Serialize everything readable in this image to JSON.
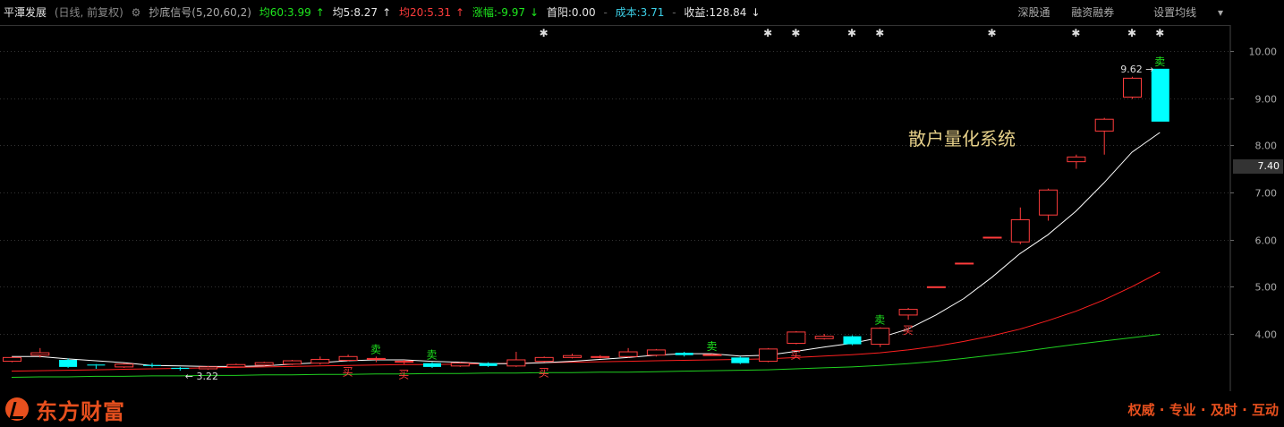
{
  "header": {
    "stock_name": "平潭发展",
    "period": "(日线, 前复权)",
    "indicator": "抄底信号(5,20,60,2)",
    "ma60": "均60:3.99",
    "ma5": "均5:8.27",
    "ma20": "均20:5.31",
    "change": "涨幅:-9.97",
    "first_yang": "首阳:0.00",
    "cost": "成本:3.71",
    "profit": "收益:128.84"
  },
  "menu": {
    "shen_gu_tong": "深股通",
    "margin": "融资融券",
    "set_ma": "设置均线"
  },
  "footer": {
    "brand": "东方财富",
    "slogan": "权威 · 专业 · 及时 · 互动"
  },
  "current_price": "7.40",
  "colors": {
    "up": "#ff3c3c",
    "down": "#00ffff",
    "ma5": "#ffffff",
    "ma20": "#ff2020",
    "ma60": "#20d020",
    "signal": "#1ee61e",
    "grid": "#333333",
    "axis_text": "#aaaaaa"
  },
  "chart_data": {
    "type": "candlestick",
    "ylim": [
      3.0,
      10.5
    ],
    "yticks": [
      "4.00",
      "5.00",
      "6.00",
      "7.00",
      "8.00",
      "9.00",
      "10.00"
    ],
    "watermark": "散户量化系统",
    "max_label": "9.62",
    "min_label": "3.22",
    "candles": [
      [
        3.42,
        3.5,
        3.4,
        3.52
      ],
      [
        3.55,
        3.6,
        3.5,
        3.7
      ],
      [
        3.45,
        3.3,
        3.28,
        3.48
      ],
      [
        3.35,
        3.33,
        3.26,
        3.36
      ],
      [
        3.3,
        3.36,
        3.28,
        3.38
      ],
      [
        3.34,
        3.32,
        3.29,
        3.38
      ],
      [
        3.28,
        3.26,
        3.22,
        3.3
      ],
      [
        3.26,
        3.3,
        3.24,
        3.32
      ],
      [
        3.3,
        3.35,
        3.29,
        3.37
      ],
      [
        3.34,
        3.39,
        3.32,
        3.41
      ],
      [
        3.36,
        3.43,
        3.34,
        3.45
      ],
      [
        3.38,
        3.46,
        3.35,
        3.52
      ],
      [
        3.44,
        3.52,
        3.42,
        3.56
      ],
      [
        3.46,
        3.48,
        3.4,
        3.52
      ],
      [
        3.4,
        3.42,
        3.36,
        3.45
      ],
      [
        3.38,
        3.3,
        3.28,
        3.4
      ],
      [
        3.32,
        3.38,
        3.3,
        3.4
      ],
      [
        3.38,
        3.32,
        3.3,
        3.4
      ],
      [
        3.32,
        3.45,
        3.3,
        3.62
      ],
      [
        3.42,
        3.5,
        3.4,
        3.52
      ],
      [
        3.5,
        3.54,
        3.48,
        3.58
      ],
      [
        3.5,
        3.52,
        3.48,
        3.55
      ],
      [
        3.52,
        3.62,
        3.5,
        3.7
      ],
      [
        3.55,
        3.66,
        3.52,
        3.68
      ],
      [
        3.6,
        3.55,
        3.52,
        3.62
      ],
      [
        3.55,
        3.56,
        3.54,
        3.58
      ],
      [
        3.5,
        3.38,
        3.36,
        3.52
      ],
      [
        3.42,
        3.68,
        3.4,
        3.7
      ],
      [
        3.8,
        4.04,
        3.78,
        4.06
      ],
      [
        3.9,
        3.95,
        3.88,
        4.0
      ],
      [
        3.95,
        3.78,
        3.76,
        3.97
      ],
      [
        3.78,
        4.12,
        3.72,
        4.14
      ],
      [
        4.4,
        4.52,
        4.3,
        4.55
      ],
      [
        5.0,
        5.0,
        5.0,
        5.0
      ],
      [
        5.5,
        5.5,
        5.5,
        5.5
      ],
      [
        6.05,
        6.05,
        6.05,
        6.05
      ],
      [
        5.95,
        6.42,
        5.9,
        6.68
      ],
      [
        6.52,
        7.05,
        6.4,
        7.08
      ],
      [
        7.65,
        7.75,
        7.5,
        7.8
      ],
      [
        8.3,
        8.55,
        7.8,
        8.58
      ],
      [
        9.02,
        9.42,
        8.98,
        9.45
      ],
      [
        9.62,
        8.5,
        8.5,
        9.62
      ]
    ],
    "ma5": [
      3.52,
      3.52,
      3.47,
      3.43,
      3.39,
      3.33,
      3.32,
      3.31,
      3.31,
      3.32,
      3.36,
      3.39,
      3.43,
      3.45,
      3.45,
      3.42,
      3.4,
      3.37,
      3.37,
      3.39,
      3.42,
      3.46,
      3.5,
      3.55,
      3.58,
      3.58,
      3.53,
      3.55,
      3.63,
      3.72,
      3.8,
      3.92,
      4.1,
      4.4,
      4.75,
      5.2,
      5.7,
      6.1,
      6.6,
      7.2,
      7.85,
      8.27
    ],
    "ma20": [
      3.21,
      3.22,
      3.23,
      3.24,
      3.25,
      3.26,
      3.27,
      3.28,
      3.29,
      3.3,
      3.31,
      3.32,
      3.33,
      3.34,
      3.35,
      3.35,
      3.36,
      3.37,
      3.38,
      3.39,
      3.4,
      3.41,
      3.42,
      3.43,
      3.44,
      3.45,
      3.46,
      3.47,
      3.5,
      3.53,
      3.56,
      3.6,
      3.66,
      3.74,
      3.84,
      3.96,
      4.1,
      4.28,
      4.48,
      4.72,
      5.0,
      5.31
    ],
    "ma60": [
      3.08,
      3.09,
      3.09,
      3.1,
      3.1,
      3.11,
      3.11,
      3.12,
      3.12,
      3.13,
      3.13,
      3.14,
      3.14,
      3.15,
      3.15,
      3.16,
      3.16,
      3.17,
      3.17,
      3.18,
      3.18,
      3.19,
      3.19,
      3.2,
      3.21,
      3.22,
      3.23,
      3.24,
      3.26,
      3.28,
      3.3,
      3.33,
      3.37,
      3.42,
      3.48,
      3.55,
      3.62,
      3.7,
      3.78,
      3.85,
      3.92,
      3.99
    ],
    "buy_signals": [
      12,
      14,
      19,
      28,
      32
    ],
    "buy_label": "买",
    "sell_signals": [
      13,
      15,
      25,
      31,
      41
    ],
    "sell_label": "卖",
    "star_markers": [
      19,
      27,
      28,
      30,
      31,
      35,
      38,
      40,
      41
    ]
  }
}
